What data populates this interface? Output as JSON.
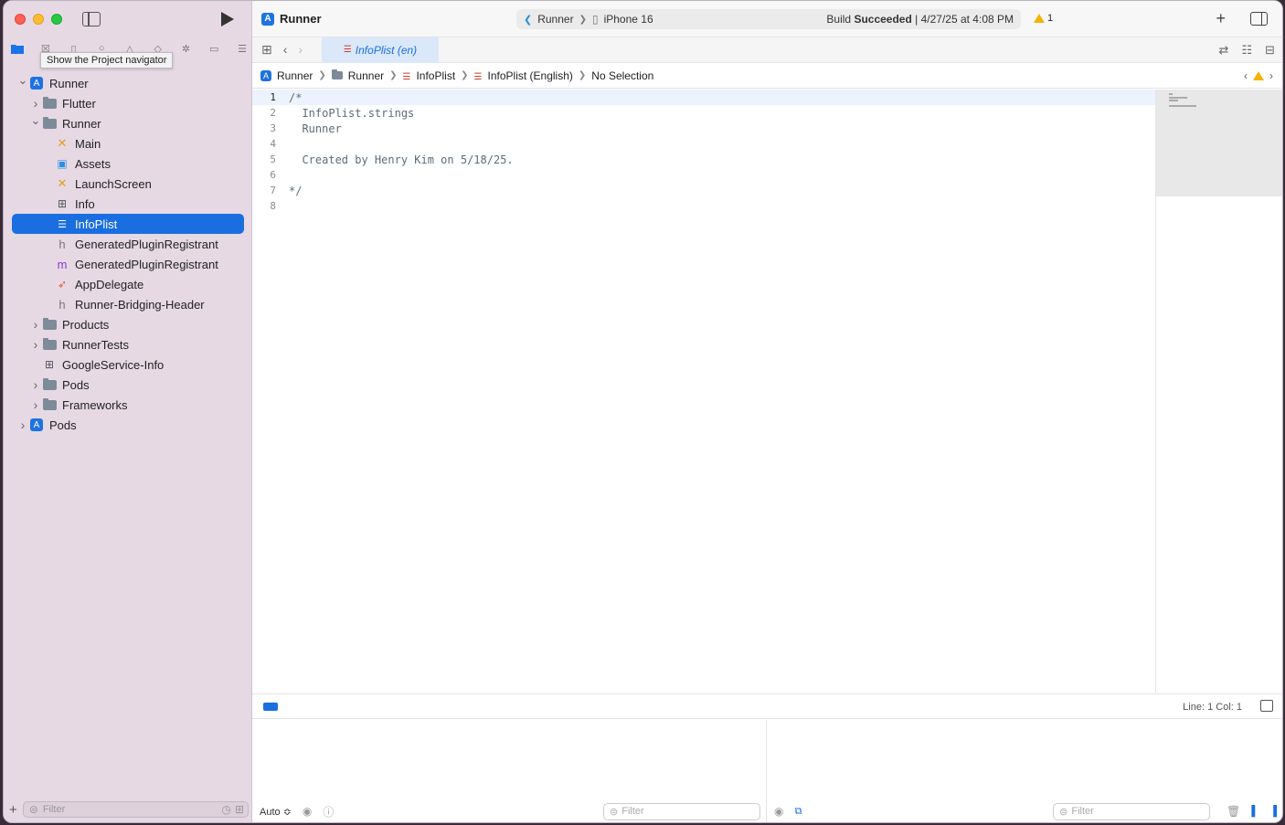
{
  "sidebar": {
    "tooltip": "Show the Project navigator",
    "filter_placeholder": "Filter",
    "tree": [
      {
        "label": "Runner",
        "icon": "xcode-project-icon",
        "depth": 0,
        "disclosure": "open"
      },
      {
        "label": "Flutter",
        "icon": "folder-icon",
        "depth": 1,
        "disclosure": "closed"
      },
      {
        "label": "Runner",
        "icon": "folder-icon",
        "depth": 1,
        "disclosure": "open"
      },
      {
        "label": "Main",
        "icon": "storyboard-icon",
        "depth": 2,
        "disclosure": "none"
      },
      {
        "label": "Assets",
        "icon": "asset-catalog-icon",
        "depth": 2,
        "disclosure": "none"
      },
      {
        "label": "LaunchScreen",
        "icon": "storyboard-icon",
        "depth": 2,
        "disclosure": "none"
      },
      {
        "label": "Info",
        "icon": "plist-icon",
        "depth": 2,
        "disclosure": "none"
      },
      {
        "label": "InfoPlist",
        "icon": "strings-file-icon",
        "depth": 2,
        "disclosure": "none",
        "selected": true
      },
      {
        "label": "GeneratedPluginRegistrant",
        "icon": "header-file-icon",
        "depth": 2,
        "disclosure": "none"
      },
      {
        "label": "GeneratedPluginRegistrant",
        "icon": "objc-file-icon",
        "depth": 2,
        "disclosure": "none"
      },
      {
        "label": "AppDelegate",
        "icon": "swift-file-icon",
        "depth": 2,
        "disclosure": "none"
      },
      {
        "label": "Runner-Bridging-Header",
        "icon": "header-file-icon",
        "depth": 2,
        "disclosure": "none"
      },
      {
        "label": "Products",
        "icon": "folder-icon",
        "depth": 1,
        "disclosure": "closed"
      },
      {
        "label": "RunnerTests",
        "icon": "folder-icon",
        "depth": 1,
        "disclosure": "closed"
      },
      {
        "label": "GoogleService-Info",
        "icon": "plist-icon",
        "depth": 1,
        "disclosure": "none"
      },
      {
        "label": "Pods",
        "icon": "folder-icon",
        "depth": 1,
        "disclosure": "closed"
      },
      {
        "label": "Frameworks",
        "icon": "folder-icon",
        "depth": 1,
        "disclosure": "closed"
      },
      {
        "label": "Pods",
        "icon": "xcode-project-icon",
        "depth": 0,
        "disclosure": "closed"
      }
    ]
  },
  "toolbar": {
    "project_title": "Runner",
    "scheme": "Runner",
    "device": "iPhone 16",
    "build_status_prefix": "Build ",
    "build_status_bold": "Succeeded",
    "build_status_time": " | 4/27/25 at 4:08 PM",
    "warning_count": "1"
  },
  "tab": {
    "label": "InfoPlist (en)"
  },
  "jumpbar": {
    "items": [
      "Runner",
      "Runner",
      "InfoPlist",
      "InfoPlist (English)",
      "No Selection"
    ]
  },
  "editor": {
    "lines": [
      {
        "n": "1",
        "text": "/*"
      },
      {
        "n": "2",
        "text": "  InfoPlist.strings"
      },
      {
        "n": "3",
        "text": "  Runner"
      },
      {
        "n": "4",
        "text": ""
      },
      {
        "n": "5",
        "text": "  Created by Henry Kim on 5/18/25."
      },
      {
        "n": "6",
        "text": ""
      },
      {
        "n": "7",
        "text": "*/"
      },
      {
        "n": "8",
        "text": ""
      }
    ]
  },
  "statusbar": {
    "line_col": "Line: 1  Col: 1"
  },
  "debug": {
    "auto_label": "Auto ≎",
    "filter_placeholder_left": "Filter",
    "filter_placeholder_right": "Filter"
  }
}
